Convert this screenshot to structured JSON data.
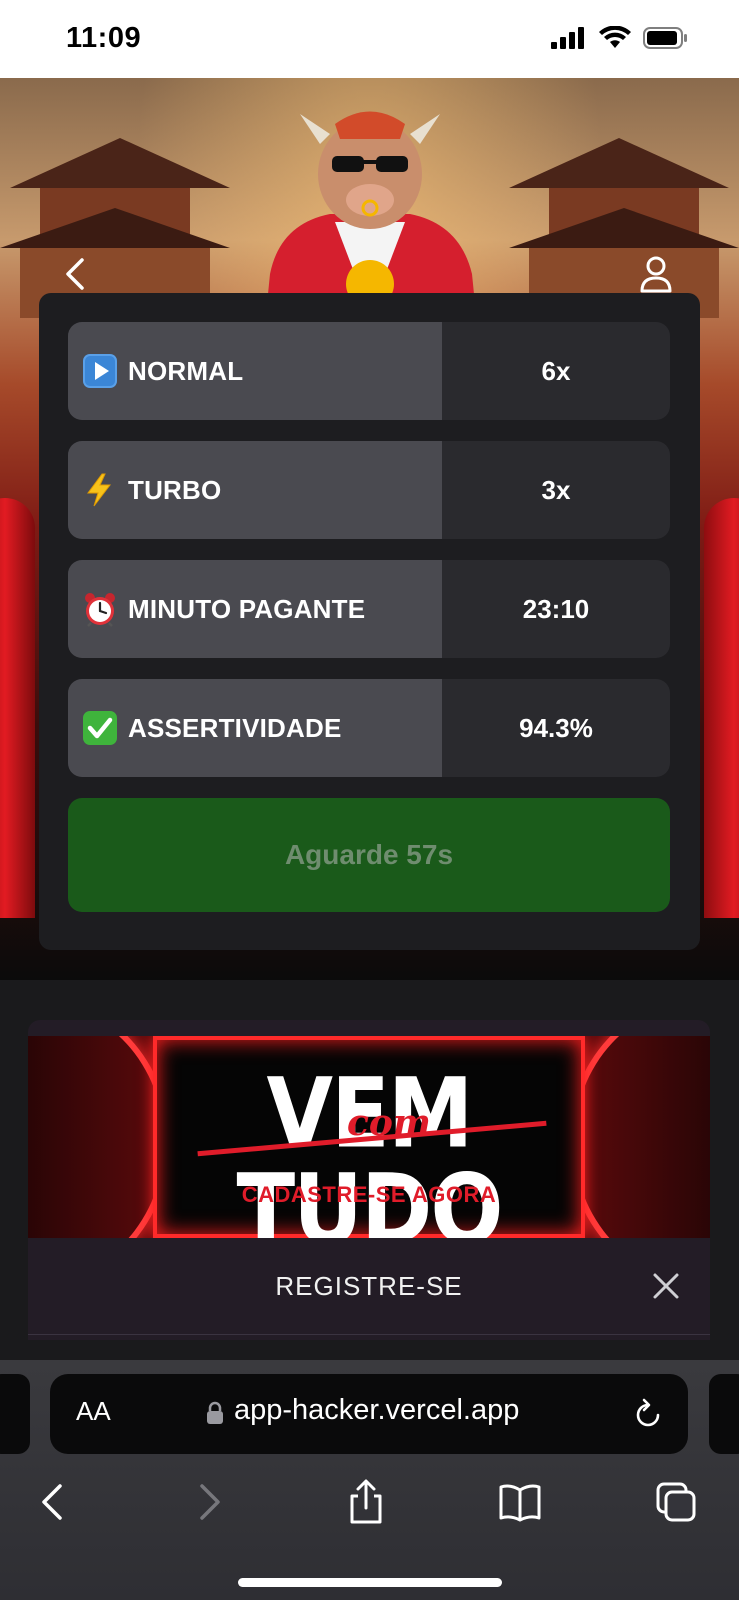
{
  "status_bar": {
    "time": "11:09"
  },
  "rows": [
    {
      "icon": "play-button-icon",
      "label": "NORMAL",
      "value": "6x"
    },
    {
      "icon": "lightning-icon",
      "label": "TURBO",
      "value": "3x"
    },
    {
      "icon": "alarm-clock-icon",
      "label": "MINUTO PAGANTE",
      "value": "23:10"
    },
    {
      "icon": "check-mark-icon",
      "label": "ASSERTIVIDADE",
      "value": "94.3%"
    }
  ],
  "wait_button": {
    "label": "Aguarde 57s"
  },
  "banner": {
    "headline": "VEM TUDO",
    "overlay_word": "com",
    "subline": "CADASTRE-SE AGORA"
  },
  "register_bar": {
    "title": "REGISTRE-SE"
  },
  "browser": {
    "text_size_label": "AA",
    "url": "app-hacker.vercel.app"
  },
  "colors": {
    "card_bg": "#1d1d20",
    "row_label_bg": "#4a4a50",
    "row_value_bg": "#2a2a2e",
    "wait_button_bg": "#1a5a1a",
    "wait_button_text": "#6f8d6f",
    "banner_red": "#e01c2a"
  }
}
